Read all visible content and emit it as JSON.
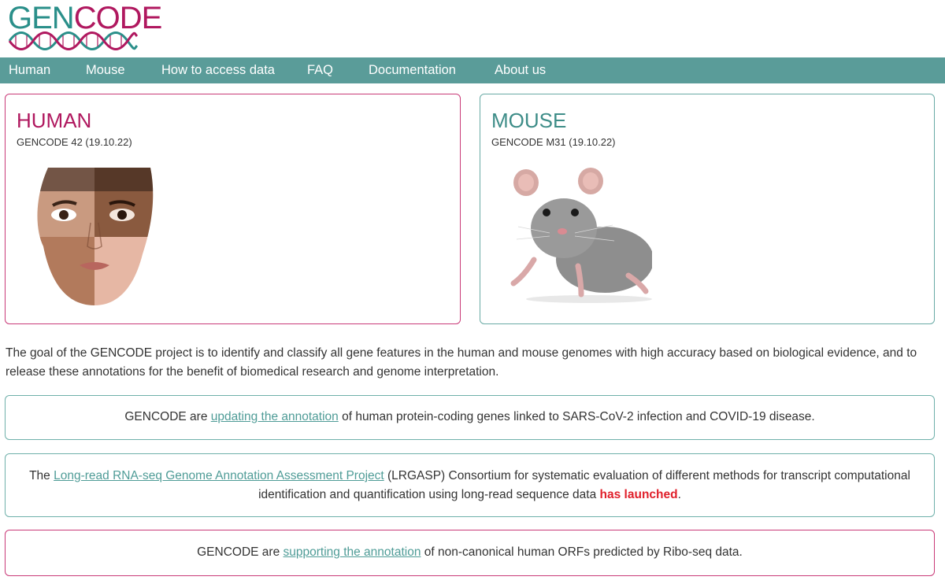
{
  "logo": {
    "part1": "GEN",
    "part2": "CODE"
  },
  "nav": [
    "Human",
    "Mouse",
    "How to access data",
    "FAQ",
    "Documentation",
    "About us"
  ],
  "human_card": {
    "title": "HUMAN",
    "release": "GENCODE 42 (19.10.22)"
  },
  "mouse_card": {
    "title": "MOUSE",
    "release": "GENCODE M31 (19.10.22)"
  },
  "intro": "The goal of the GENCODE project is to identify and classify all gene features in the human and mouse genomes with high accuracy based on biological evidence, and to release these annotations for the benefit of biomedical research and genome interpretation.",
  "notices": {
    "covid": {
      "pre": "GENCODE are ",
      "link": "updating the annotation",
      "post": " of human protein-coding genes linked to SARS-CoV-2 infection and COVID-19 disease."
    },
    "lrgasp": {
      "pre": "The ",
      "link": "Long-read RNA-seq Genome Annotation Assessment Project",
      "mid": " (LRGASP) Consortium for systematic evaluation of different methods for transcript computational identification and quantification using long-read sequence data ",
      "highlight": "has launched",
      "post": "."
    },
    "riboseq": {
      "pre": "GENCODE are ",
      "link": "supporting the annotation",
      "post": " of non-canonical human ORFs predicted by Ribo-seq data."
    }
  },
  "colors": {
    "nav_bg": "#5a9c99",
    "brand_pink": "#b0185f",
    "brand_teal": "#3e8d88",
    "link": "#4f9c97",
    "highlight": "#e0202b"
  }
}
